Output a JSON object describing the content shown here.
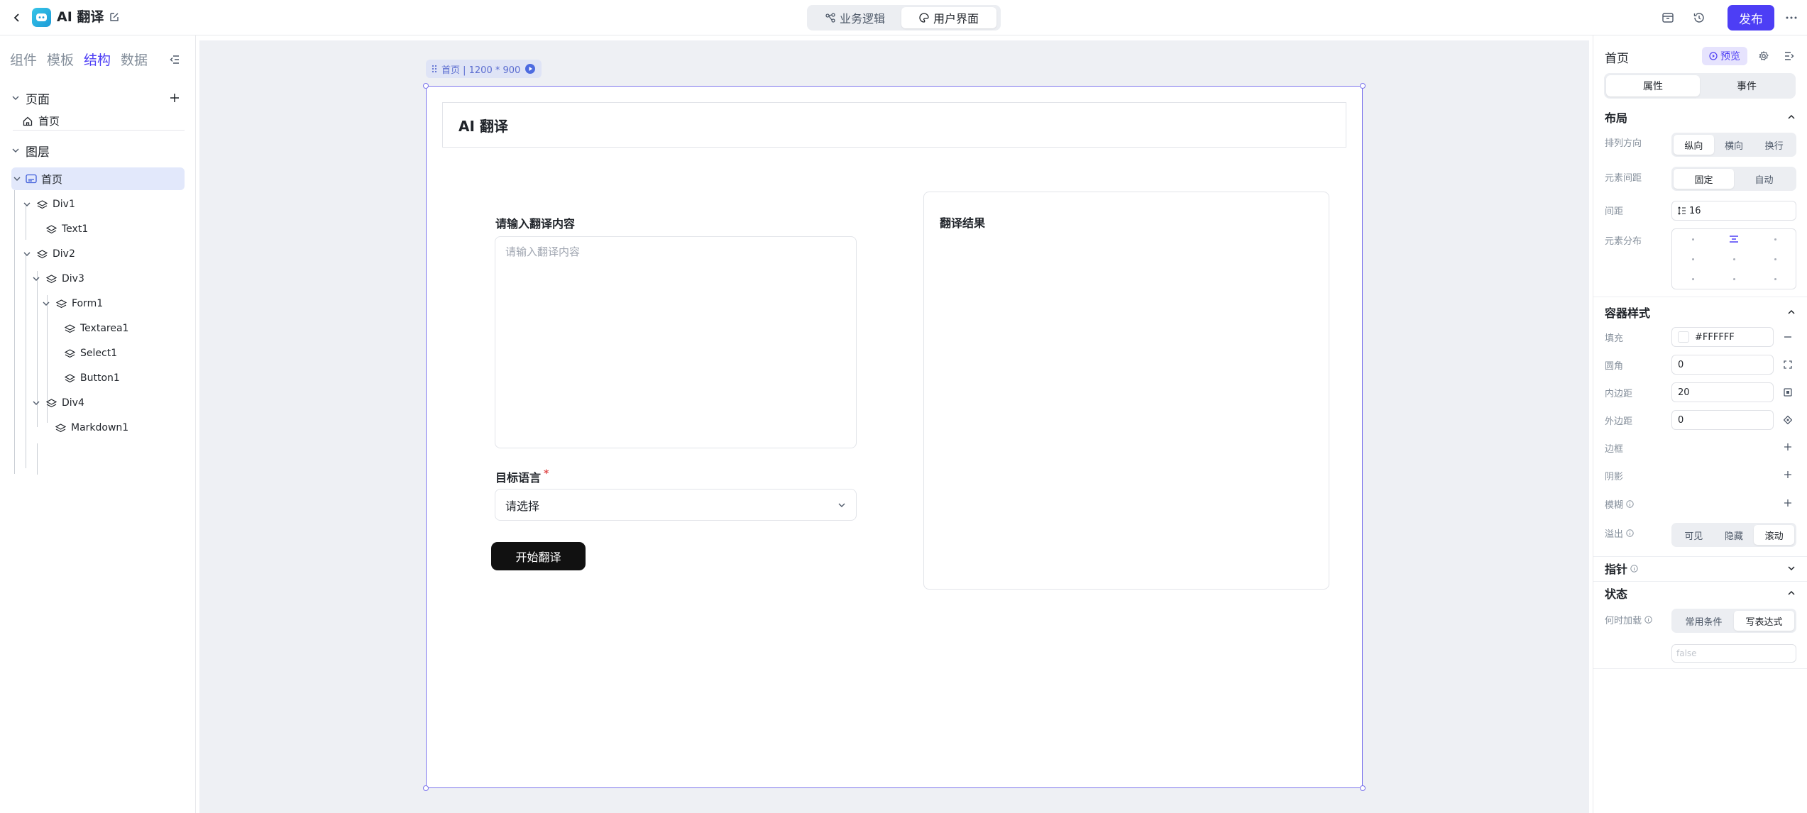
{
  "app": {
    "title": "AI 翻译"
  },
  "mode_switch": {
    "logic": "业务逻辑",
    "ui": "用户界面"
  },
  "topbar": {
    "publish": "发布"
  },
  "left_panel": {
    "tabs": [
      "组件",
      "模板",
      "结构",
      "数据"
    ],
    "pages_section": "页面",
    "page_item": "首页",
    "layers_section": "图层",
    "layers": {
      "root": "首页",
      "div1": "Div1",
      "text1": "Text1",
      "div2": "Div2",
      "div3": "Div3",
      "form1": "Form1",
      "textarea1": "Textarea1",
      "select1": "Select1",
      "button1": "Button1",
      "div4": "Div4",
      "markdown1": "Markdown1"
    }
  },
  "canvas": {
    "frame_label": "首页 | 1200 * 900",
    "header_title": "AI 翻译",
    "input_label": "请输入翻译内容",
    "textarea_placeholder": "请输入翻译内容",
    "lang_label": "目标语言",
    "required_mark": "*",
    "select_value": "请选择",
    "translate_button": "开始翻译",
    "result_title": "翻译结果"
  },
  "right_panel": {
    "title": "首页",
    "preview": "预览",
    "tabs": [
      "属性",
      "事件"
    ],
    "layout": {
      "title": "布局",
      "direction_label": "排列方向",
      "direction_options": [
        "纵向",
        "横向",
        "换行"
      ],
      "spacing_label": "元素间距",
      "spacing_options": [
        "固定",
        "自动"
      ],
      "gap_label": "间距",
      "gap_value": "16",
      "distribution_label": "元素分布"
    },
    "container": {
      "title": "容器样式",
      "fill_label": "填充",
      "fill_value": "#FFFFFF",
      "radius_label": "圆角",
      "radius_value": "0",
      "padding_label": "内边距",
      "padding_value": "20",
      "margin_label": "外边距",
      "margin_value": "0",
      "border_label": "边框",
      "shadow_label": "阴影",
      "blur_label": "模糊",
      "overflow_label": "溢出",
      "overflow_options": [
        "可见",
        "隐藏",
        "滚动"
      ]
    },
    "pointer": {
      "title": "指针"
    },
    "state": {
      "title": "状态",
      "load_label": "何时加载",
      "load_options": [
        "常用条件",
        "写表达式"
      ],
      "expr_placeholder": "false"
    }
  },
  "colors": {
    "accent": "#4d3ef5",
    "selection": "#7b74ec",
    "canvas_bg": "#eef0f4"
  }
}
